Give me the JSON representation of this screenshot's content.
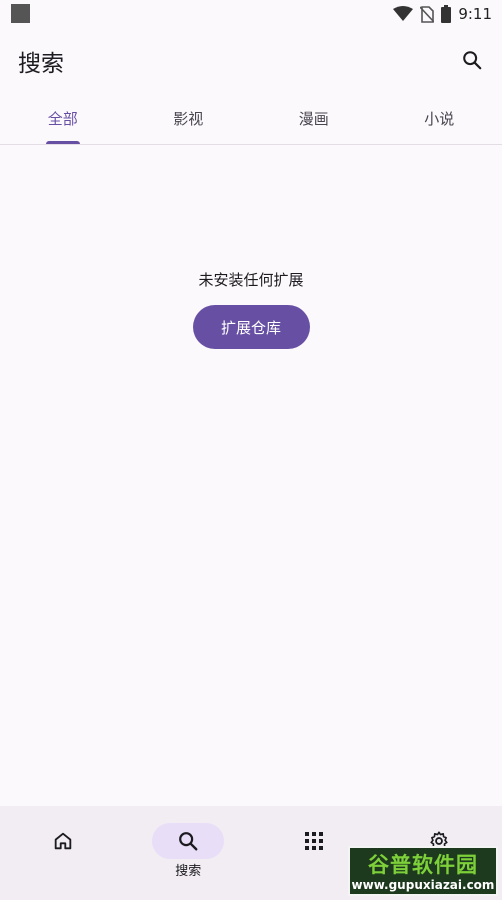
{
  "status_bar": {
    "time": "9:11",
    "icons": [
      "app-notification-icon",
      "wifi-icon",
      "no-sim-icon",
      "battery-icon"
    ]
  },
  "header": {
    "title": "搜索",
    "action_icon": "search-icon"
  },
  "tabs": [
    {
      "label": "全部",
      "active": true
    },
    {
      "label": "影视",
      "active": false
    },
    {
      "label": "漫画",
      "active": false
    },
    {
      "label": "小说",
      "active": false
    }
  ],
  "empty_state": {
    "message": "未安装任何扩展",
    "button_label": "扩展仓库"
  },
  "bottom_nav": [
    {
      "icon": "home-icon",
      "label": "",
      "active": false
    },
    {
      "icon": "search-icon",
      "label": "搜索",
      "active": true
    },
    {
      "icon": "apps-grid-icon",
      "label": "",
      "active": false
    },
    {
      "icon": "settings-icon",
      "label": "",
      "active": false
    }
  ],
  "watermark": {
    "brand": "谷普软件园",
    "url": "www.gupuxiazai.com"
  },
  "colors": {
    "accent": "#6750A4",
    "background": "#FCF9FC",
    "nav_background": "#F1EDF2",
    "nav_active_pill": "#E8DEF8"
  }
}
